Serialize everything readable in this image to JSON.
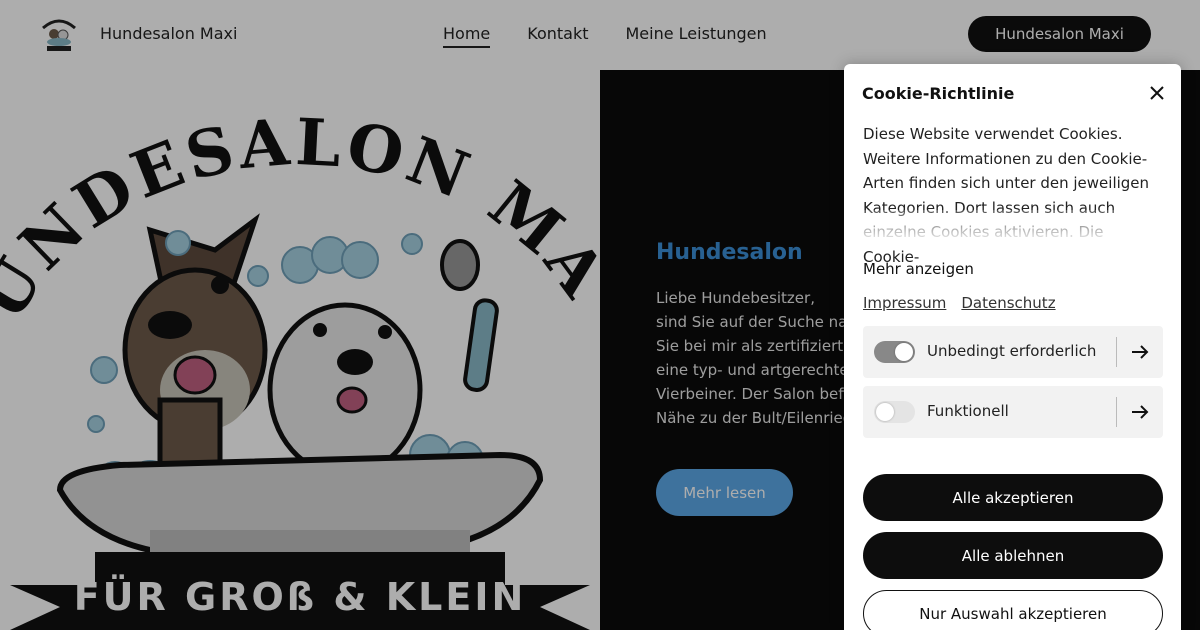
{
  "header": {
    "site_name": "Hundesalon Maxi",
    "nav": [
      "Home",
      "Kontakt",
      "Meine Leistungen"
    ],
    "cta_label": "Hundesalon Maxi"
  },
  "hero": {
    "logo_arc_text": "HUNDESALON MAXI",
    "logo_banner_text": "FÜR GROß & KLEIN",
    "title": "Hundesalon",
    "text_lines": [
      "Liebe Hundebesitzer,",
      "sind Sie auf der Suche nac",
      "Sie bei mir als zertifizierte",
      "eine typ- und artgerechte",
      "Vierbeiner. Der Salon befin",
      "Nähe zu der Bult/Eilenried"
    ],
    "button_label": "Mehr lesen"
  },
  "cookie": {
    "title": "Cookie-Richtlinie",
    "body": "Diese Website verwendet Cookies. Weitere Informationen zu den Cookie-Arten finden sich unter den jeweiligen Kategorien. Dort lassen sich auch einzelne Cookies aktivieren. Die Cookie-",
    "show_more": "Mehr anzeigen",
    "links": [
      "Impressum",
      "Datenschutz"
    ],
    "categories": [
      {
        "label": "Unbedingt erforderlich",
        "enabled": true
      },
      {
        "label": "Funktionell",
        "enabled": false
      }
    ],
    "buttons": {
      "accept_all": "Alle akzeptieren",
      "reject_all": "Alle ablehnen",
      "accept_selection": "Nur Auswahl akzeptieren"
    }
  },
  "colors": {
    "accent_blue": "#3b8fd8",
    "button_blue": "#5ca8e8",
    "dark": "#0b0b0b"
  }
}
